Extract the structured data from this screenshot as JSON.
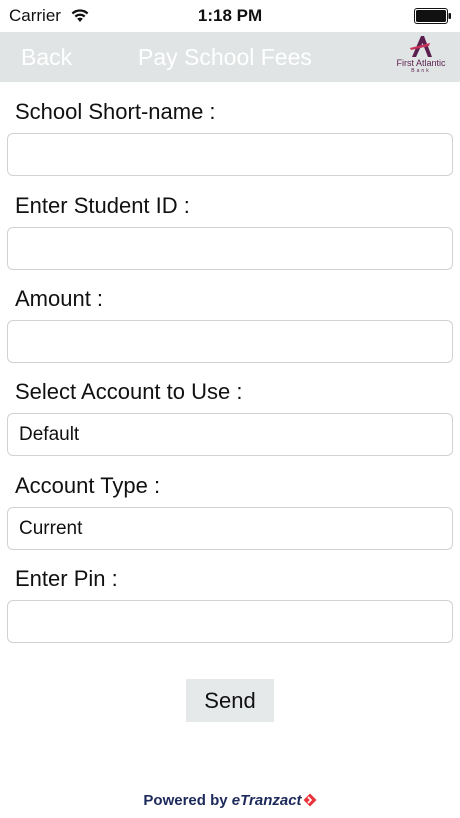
{
  "status_bar": {
    "carrier": "Carrier",
    "time": "1:18 PM",
    "wifi_icon": "wifi-icon",
    "battery_icon": "battery-icon"
  },
  "nav_bar": {
    "back_label": "Back",
    "title": "Pay School Fees",
    "logo": {
      "name": "First Atlantic",
      "sub": "Bank",
      "icon": "first-atlantic-logo-icon",
      "color": "#5a1f4e"
    },
    "background": "#e0e4e4"
  },
  "form": {
    "school_short_name": {
      "label": "School Short-name :",
      "value": ""
    },
    "student_id": {
      "label": "Enter Student ID :",
      "value": ""
    },
    "amount": {
      "label": "Amount :",
      "value": ""
    },
    "account": {
      "label": "Select Account to Use :",
      "selected": "Default"
    },
    "account_type": {
      "label": "Account Type :",
      "selected": "Current"
    },
    "pin": {
      "label": "Enter Pin :",
      "value": ""
    },
    "send_label": "Send"
  },
  "footer": {
    "powered_by": "Powered by",
    "brand": "eTranzact",
    "brand_icon": "etranzact-diamond-icon",
    "brand_accent": "#e8343a"
  }
}
